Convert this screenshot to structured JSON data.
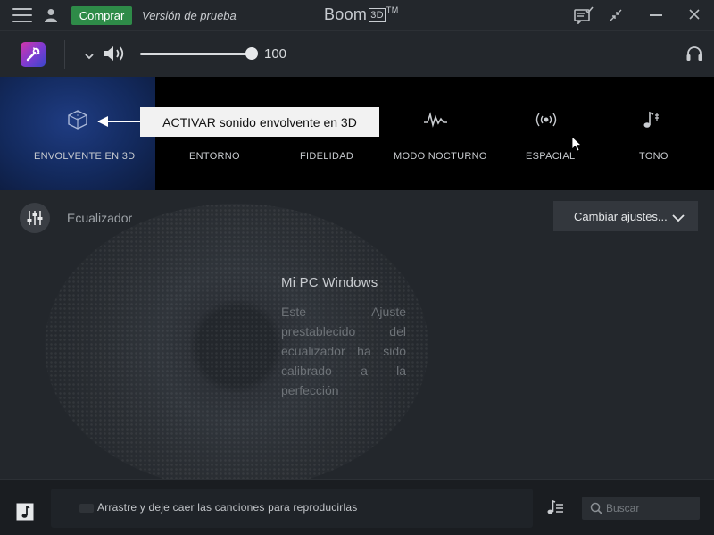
{
  "titlebar": {
    "buy_label": "Comprar",
    "trial_label": "Versión de prueba",
    "app_name": "Boom",
    "app_3d": "3D",
    "app_tm": "TM"
  },
  "volume": {
    "value": "100",
    "level": 1.0
  },
  "effects": {
    "items": [
      {
        "label": "ENVOLVENTE EN 3D",
        "icon": "cube-icon",
        "active": true
      },
      {
        "label": "ENTORNO",
        "icon": "environment-icon"
      },
      {
        "label": "FIDELIDAD",
        "icon": "fidelity-icon"
      },
      {
        "label": "MODO NOCTURNO",
        "icon": "waveform-icon"
      },
      {
        "label": "ESPACIAL",
        "icon": "spatial-icon"
      },
      {
        "label": "TONO",
        "icon": "music-note-icon"
      }
    ],
    "tooltip": "ACTIVAR sonido envolvente en 3D"
  },
  "equalizer": {
    "label": "Ecualizador",
    "preset_button": "Cambiar ajustes...",
    "preset_title": "Mi PC Windows",
    "preset_description": "Este Ajuste prestablecido del ecualizador ha sido calibrado a la perfección"
  },
  "bottom": {
    "dropzone_text": "Arrastre y deje caer las canciones para reproducirlas",
    "search_placeholder": "Buscar"
  },
  "colors": {
    "buy_green": "#2e8b48",
    "active_effect_blue": "#1f3c82",
    "background": "#23272c"
  }
}
